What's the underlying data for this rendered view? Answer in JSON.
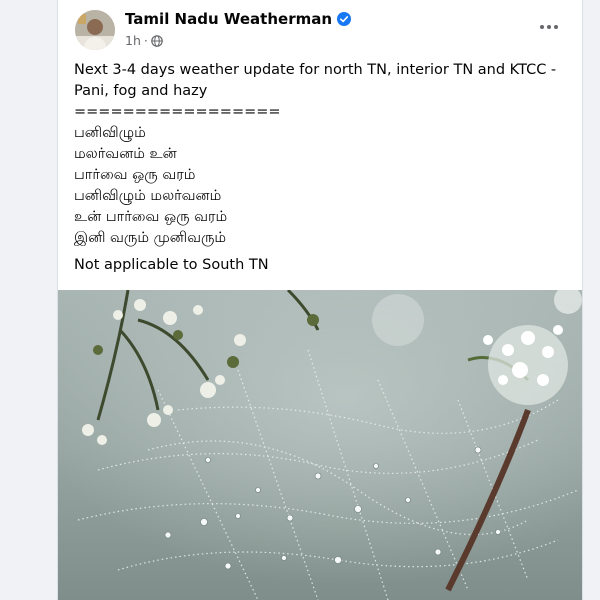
{
  "post": {
    "author": "Tamil Nadu Weatherman",
    "time": "1h",
    "separator": "·",
    "lines": [
      "Next 3-4 days weather update for north TN, interior TN and KTCC -",
      "Pani, fog and hazy",
      "=================",
      "பனிவிழும்",
      "மலர்வனம் உன்",
      "பார்வை ஒரு வரம்",
      "பனிவிழும் மலர்வனம்",
      "உன் பார்வை ஒரு வரம்",
      "இனி வரும் முனிவரும்"
    ],
    "footer_line": "Not applicable to South TN"
  },
  "icons": {
    "verified": "verified-badge-icon",
    "privacy": "globe-icon",
    "more": "more-options-icon"
  },
  "colors": {
    "verified_blue": "#1877f2",
    "meta_gray": "#65676b",
    "text": "#050505"
  }
}
